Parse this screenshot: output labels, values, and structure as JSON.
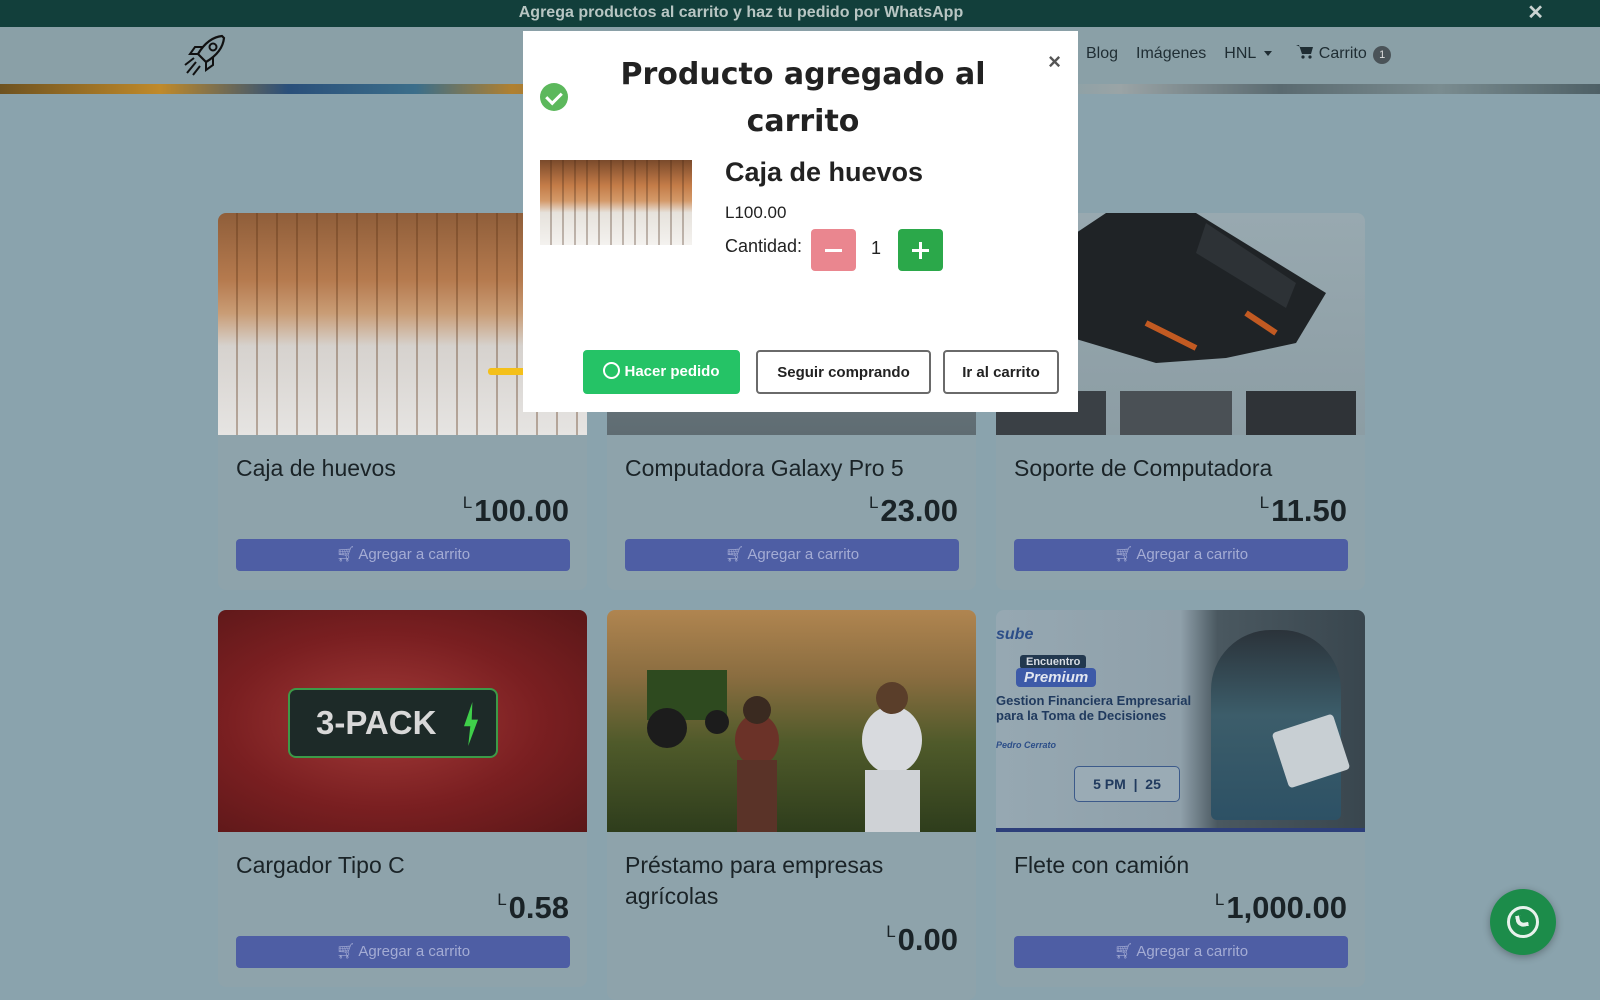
{
  "announcement": {
    "text": "Agrega productos al carrito y haz tu pedido por WhatsApp"
  },
  "nav": {
    "links": [
      "Blog",
      "Imágenes"
    ],
    "currency": "HNL",
    "cart_label": "Carrito",
    "cart_count": "1"
  },
  "products": [
    {
      "name": "Caja de huevos",
      "currency": "L",
      "price": "100.00",
      "button": "Agregar a carrito"
    },
    {
      "name": "Computadora Galaxy Pro 5",
      "currency": "L",
      "price": "23.00",
      "button": "Agregar a carrito"
    },
    {
      "name": "Soporte de Computadora",
      "currency": "L",
      "price": "11.50",
      "button": "Agregar a carrito"
    },
    {
      "name": "Cargador Tipo C",
      "currency": "L",
      "price": "0.58",
      "button": "Agregar a carrito"
    },
    {
      "name": "Préstamo para empresas agrícolas",
      "currency": "L",
      "price": "0.00"
    },
    {
      "name": "Flete con camión",
      "currency": "L",
      "price": "1,000.00",
      "button": "Agregar a carrito"
    }
  ],
  "product_images": {
    "cable_pack": "3-PACK",
    "course": {
      "brand": "sube",
      "tag1": "Encuentro",
      "tag2": "Premium",
      "title": "Gestion Financiera Empresarial para la Toma de Decisiones",
      "author": "Pedro Cerrato",
      "time": "5 PM",
      "date": "25"
    }
  },
  "modal": {
    "title": "Producto agregado al carrito",
    "close": "×",
    "product_name": "Caja de huevos",
    "product_price": "L100.00",
    "quantity_label": "Cantidad:",
    "quantity": "1",
    "order_button": "Hacer pedido",
    "continue_button": "Seguir comprando",
    "cart_button": "Ir al carrito"
  },
  "colors": {
    "order_green": "#25c366",
    "plus_green": "#2ba84a",
    "minus_red": "#ea868f",
    "add_button_blue": "#4e5ea4",
    "arrow_yellow": "#f4c01a"
  },
  "icons": [
    "close-icon",
    "rocket-logo-icon",
    "cart-icon",
    "check-circle-icon",
    "whatsapp-icon",
    "arrow-icon"
  ]
}
